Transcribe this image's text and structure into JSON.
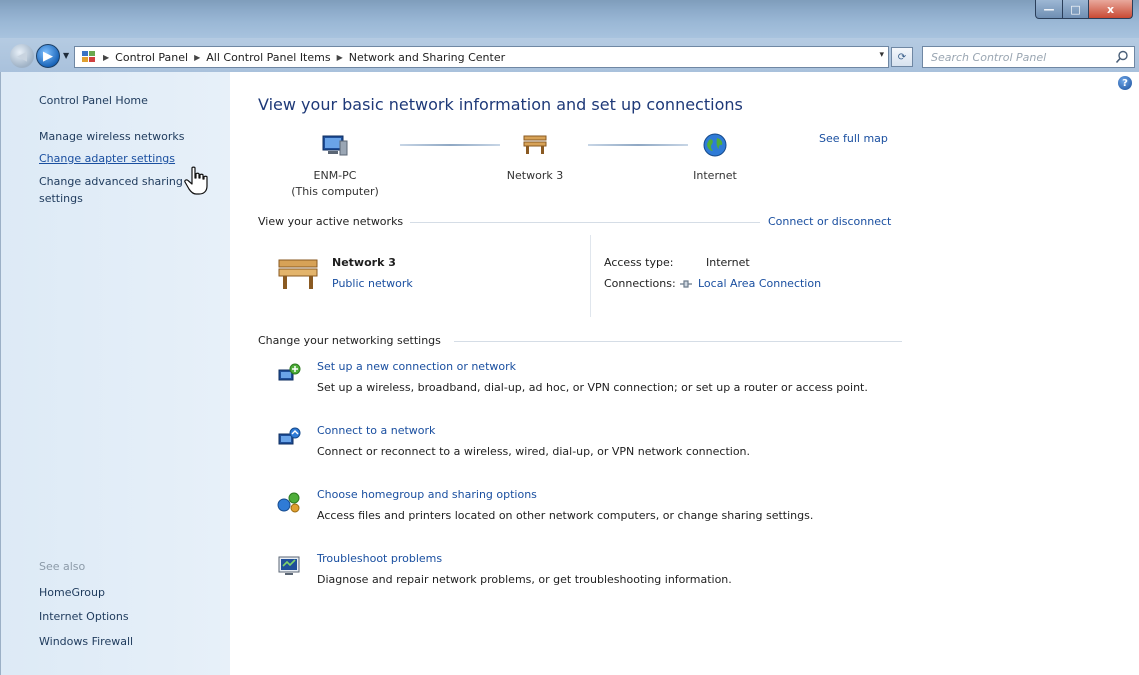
{
  "window": {
    "controls": {
      "minimize": "—",
      "maximize": "□",
      "close": "x"
    }
  },
  "navigation": {
    "back": "◀",
    "forward": "▶",
    "recent": "▼",
    "breadcrumbs": [
      "Control Panel",
      "All Control Panel Items",
      "Network and Sharing Center"
    ],
    "address_dropdown": "▾",
    "refresh": "⟳",
    "search_placeholder": "Search Control Panel"
  },
  "left_pane": {
    "home": "Control Panel Home",
    "links": [
      "Manage wireless networks",
      "Change adapter settings",
      "Change advanced sharing settings"
    ],
    "see_also_label": "See also",
    "see_also": [
      "HomeGroup",
      "Internet Options",
      "Windows Firewall"
    ]
  },
  "main": {
    "help": "?",
    "title": "View your basic network information and set up connections",
    "see_full_map": "See full map",
    "map": {
      "computer_name": "ENM-PC",
      "computer_sub": "(This computer)",
      "network": "Network 3",
      "internet": "Internet"
    },
    "active_networks": {
      "heading": "View your active networks",
      "connect_link": "Connect or disconnect",
      "network_name": "Network 3",
      "network_category": "Public network",
      "access_type_label": "Access type:",
      "access_type_value": "Internet",
      "connections_label": "Connections:",
      "connections_value": "Local Area Connection"
    },
    "change_settings": {
      "heading": "Change your networking settings",
      "tasks": [
        {
          "link": "Set up a new connection or network",
          "desc": "Set up a wireless, broadband, dial-up, ad hoc, or VPN connection; or set up a router or access point."
        },
        {
          "link": "Connect to a network",
          "desc": "Connect or reconnect to a wireless, wired, dial-up, or VPN network connection."
        },
        {
          "link": "Choose homegroup and sharing options",
          "desc": "Access files and printers located on other network computers, or change sharing settings."
        },
        {
          "link": "Troubleshoot problems",
          "desc": "Diagnose and repair network problems, or get troubleshooting information."
        }
      ]
    }
  },
  "colors": {
    "link": "#1a4fa0",
    "title": "#1e3978",
    "left_pane_bg": "#ddeaf6",
    "chrome": "#a8c3de"
  }
}
